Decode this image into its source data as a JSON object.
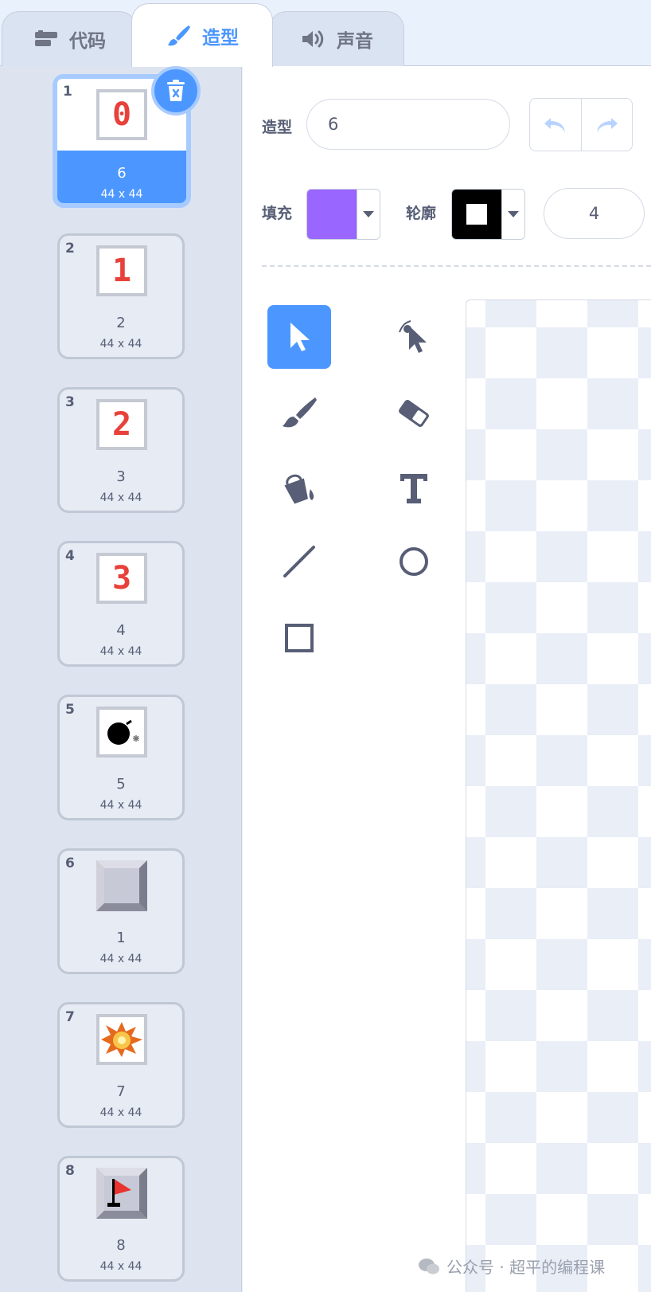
{
  "tabs": [
    {
      "label": "代码",
      "icon": "code-blocks-icon"
    },
    {
      "label": "造型",
      "icon": "paintbrush-icon"
    },
    {
      "label": "声音",
      "icon": "speaker-icon"
    }
  ],
  "costumes": [
    {
      "num": "1",
      "name": "6",
      "size": "44 x 44",
      "glyph": "0"
    },
    {
      "num": "2",
      "name": "2",
      "size": "44 x 44",
      "glyph": "1"
    },
    {
      "num": "3",
      "name": "3",
      "size": "44 x 44",
      "glyph": "2"
    },
    {
      "num": "4",
      "name": "4",
      "size": "44 x 44",
      "glyph": "3"
    },
    {
      "num": "5",
      "name": "5",
      "size": "44 x 44",
      "glyph": "bomb"
    },
    {
      "num": "6",
      "name": "1",
      "size": "44 x 44",
      "glyph": "block"
    },
    {
      "num": "7",
      "name": "7",
      "size": "44 x 44",
      "glyph": "explosion"
    },
    {
      "num": "8",
      "name": "8",
      "size": "44 x 44",
      "glyph": "flag"
    }
  ],
  "editor": {
    "costume_label": "造型",
    "costume_name": "6",
    "fill_label": "填充",
    "outline_label": "轮廓",
    "outline_width": "4",
    "fill_color": "#9966ff",
    "outline_color": "#000000"
  },
  "tools": [
    "select-tool",
    "reshape-tool",
    "brush-tool",
    "eraser-tool",
    "fill-tool",
    "text-tool",
    "line-tool",
    "circle-tool",
    "rectangle-tool"
  ],
  "watermark": "公众号 · 超平的编程课",
  "colors": {
    "accent": "#4c97ff",
    "digit_red": "#e8413b"
  }
}
